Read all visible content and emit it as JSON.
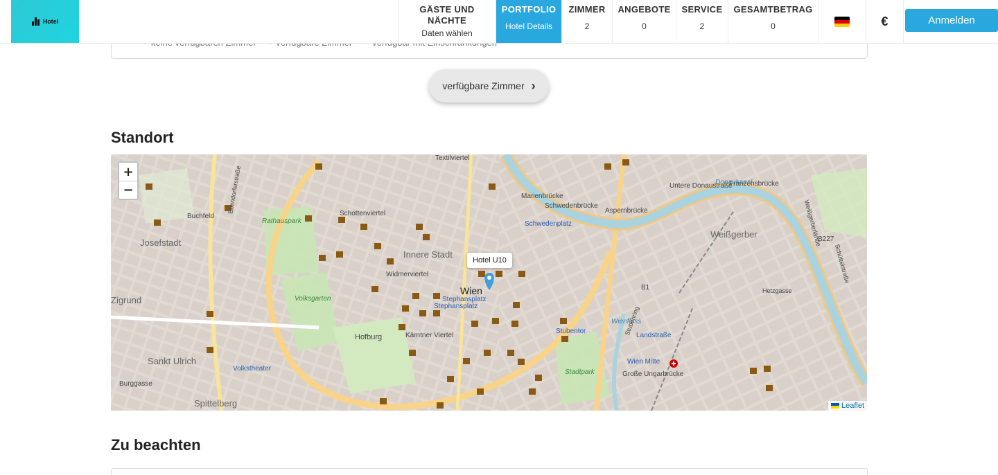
{
  "header": {
    "logo_text": "Hotel",
    "nav": [
      {
        "title": "GÄSTE UND NÄCHTE",
        "sub": "Daten wählen",
        "active": false
      },
      {
        "title": "PORTFOLIO",
        "sub": "Hotel Details",
        "active": true
      },
      {
        "title": "ZIMMER",
        "sub": "2",
        "active": false
      },
      {
        "title": "ANGEBOTE",
        "sub": "0",
        "active": false
      },
      {
        "title": "SERVICE",
        "sub": "2",
        "active": false
      },
      {
        "title": "GESAMTBETRAG",
        "sub": "0",
        "active": false
      }
    ],
    "language_icon": "german-flag-icon",
    "currency": "€",
    "login_label": "Anmelden",
    "accent": "#29a8e0"
  },
  "legend": {
    "items": [
      "keine verfügbaren Zimmer",
      "verfügbare Zimmer",
      "verfügbar mit Einschränkungen"
    ]
  },
  "rooms_button": {
    "label": "verfügbare Zimmer",
    "icon": "chevron-right-icon"
  },
  "location": {
    "heading": "Standort",
    "map": {
      "zoom_in": "+",
      "zoom_out": "−",
      "popup": "Hotel U10",
      "attribution": "Leaflet",
      "labels": [
        "Innere Stadt",
        "Josefstadt",
        "Weißgerber",
        "Wien",
        "Stephansplatz",
        "Stephansplatz",
        "Schwedenplatz",
        "Landstraße",
        "Wien Mitte",
        "Stubentor",
        "Hofburg",
        "Kärntner Viertel",
        "Volksgarten",
        "Rathauspark",
        "Stadtpark",
        "Sankt Ulrich",
        "Spittelberg",
        "Volkstheater",
        "Schottenviertel",
        "Widmerviertel",
        "Textilviertel",
        "Marienbrücke",
        "Schwedenbrücke",
        "Aspernbrücke",
        "Große Ungarbrücke",
        "Franzensbrücke",
        "Untere Donaustraße",
        "Buchfeld",
        "B227",
        "B1",
        "Burggasse",
        "Donaukanal",
        "Wienfluss",
        "Hetzgasse",
        "Weißgerberlände",
        "Schüttelstraße",
        "Ebendorferstraße",
        "Stubenring",
        "Zigrund"
      ]
    }
  },
  "notes": {
    "heading": "Zu beachten"
  }
}
